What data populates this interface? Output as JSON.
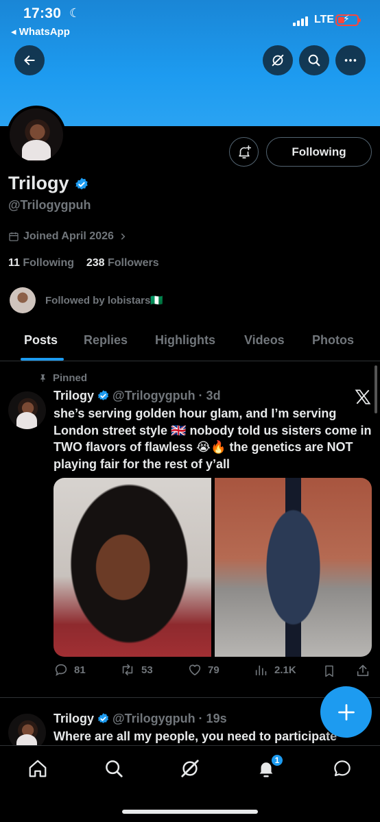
{
  "status_bar": {
    "time": "17:30",
    "back_app": "◂ WhatsApp",
    "network": "LTE"
  },
  "profile": {
    "name": "Trilogy",
    "handle": "@Trilogygpuh",
    "joined": "Joined April 2026",
    "following_count": "11",
    "following_label": "Following",
    "followers_count": "238",
    "followers_label": "Followers",
    "followed_by": "Followed by lobistars🇳🇬",
    "follow_button": "Following"
  },
  "tabs": [
    "Posts",
    "Replies",
    "Highlights",
    "Videos",
    "Photos"
  ],
  "pinned_post": {
    "pinned_label": "Pinned",
    "author": "Trilogy",
    "handle_time": "@Trilogygpuh · 3d",
    "text": "she’s serving golden hour glam, and I’m serving London street style 🇬🇧 nobody told us sisters come in TWO flavors of flawless 😭🔥 the genetics are NOT playing fair for the rest of y’all",
    "replies": "81",
    "reposts": "53",
    "likes": "79",
    "views": "2.1K"
  },
  "second_post": {
    "author": "Trilogy",
    "handle_time": "@Trilogygpuh · 19s",
    "text": "Where are all my people, you need to participate"
  },
  "notifications_badge": "1",
  "colors": {
    "accent": "#1d9bf0",
    "background": "#000000",
    "muted": "#71767b"
  }
}
